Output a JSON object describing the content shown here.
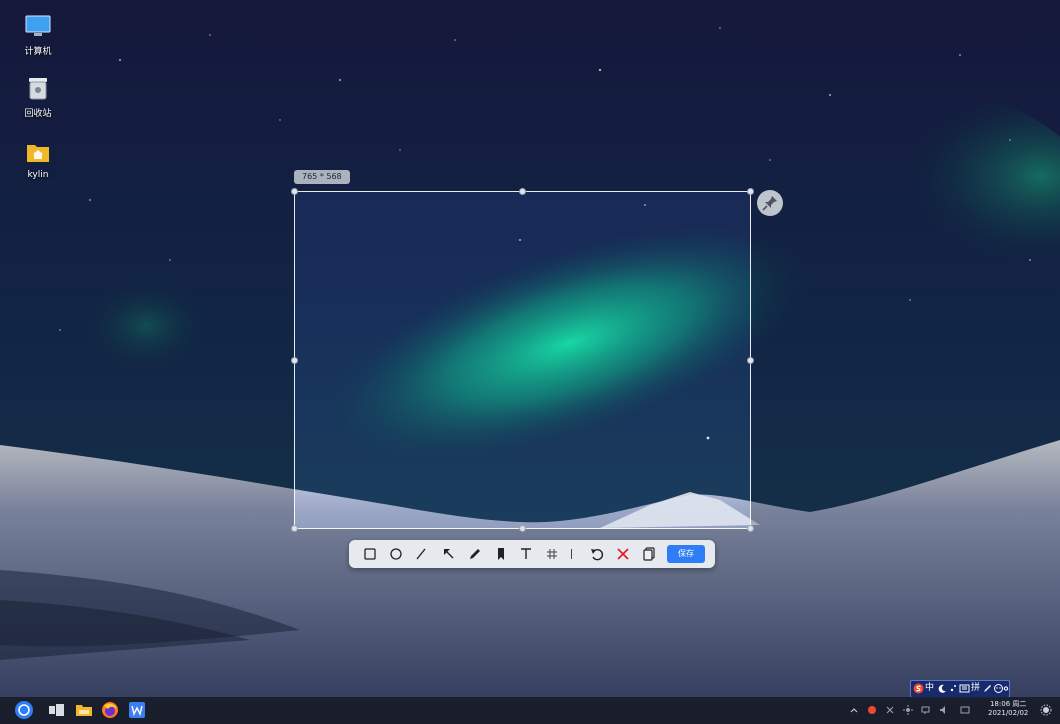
{
  "desktop": {
    "icons": [
      {
        "label": "计算机",
        "icon": "monitor-icon"
      },
      {
        "label": "回收站",
        "icon": "trash-icon"
      },
      {
        "label": "kylin",
        "icon": "home-folder-icon"
      }
    ]
  },
  "screenshot": {
    "size_label": "765 * 568",
    "toolbar": {
      "tools": [
        "rectangle-icon",
        "ellipse-icon",
        "line-icon",
        "arrow-icon",
        "pen-icon",
        "marker-icon",
        "text-icon",
        "mosaic-icon",
        "undo-icon",
        "cancel-icon",
        "copy-icon"
      ],
      "save_label": "保存"
    },
    "pin_icon": "pin-icon"
  },
  "taskbar": {
    "apps": [
      "start-menu-icon",
      "multitask-view-icon",
      "file-manager-icon",
      "firefox-icon",
      "wps-writer-icon"
    ],
    "ime": [
      "sogou-logo-icon",
      "中",
      "moon-icon",
      "punctuation-icon",
      "keyboard-icon",
      "拼",
      "pen-icon",
      "emoji-icon",
      "gear-icon"
    ],
    "tray": [
      "chevron-up-icon",
      "sogou-tray-icon",
      "network-icon",
      "brightness-icon",
      "device-icon",
      "volume-icon",
      "notification-icon"
    ],
    "clock": {
      "time": "18:06 周二",
      "date": "2021/02/02"
    },
    "show_desktop": "night-mode-icon"
  }
}
